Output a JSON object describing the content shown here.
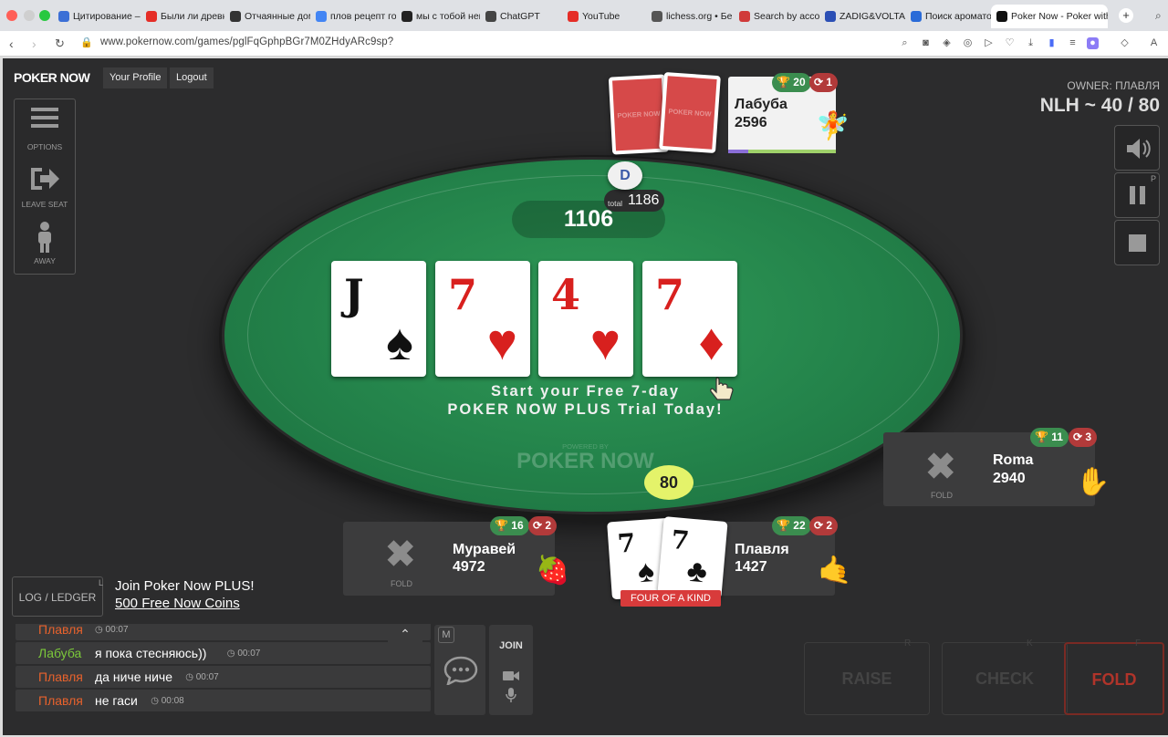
{
  "browser": {
    "tabs": [
      {
        "label": "Цитирование –",
        "icon": "bookmark-icon",
        "color": "#3b6fd6"
      },
      {
        "label": "Были ли древн",
        "icon": "youtube-icon",
        "color": "#e52d27"
      },
      {
        "label": "Отчаянные дом",
        "icon": "sh-icon",
        "color": "#333333"
      },
      {
        "label": "плов рецепт го",
        "icon": "google-icon",
        "color": "#4285f4"
      },
      {
        "label": "мы с тобой нем",
        "icon": "app-icon",
        "color": "#222222"
      },
      {
        "label": "ChatGPT",
        "icon": "chatgpt-icon",
        "color": "#444444"
      },
      {
        "label": "YouTube",
        "icon": "youtube-icon",
        "color": "#e52d27"
      },
      {
        "label": "lichess.org • Бе",
        "icon": "lichess-icon",
        "color": "#555555"
      },
      {
        "label": "Search by acco",
        "icon": "search-site-icon",
        "color": "#d03a3a"
      },
      {
        "label": "ZADIG&VOLTAIR",
        "icon": "zadig-icon",
        "color": "#2b4fb5"
      },
      {
        "label": "Поиск аромато",
        "icon": "f-icon",
        "color": "#2a6bd8"
      },
      {
        "label": "Poker Now - Poker with",
        "icon": "pokernow-icon",
        "color": "#111111"
      }
    ],
    "url": "www.pokernow.com/games/pglFqGphpBGr7M0ZHdyARc9sp?"
  },
  "header": {
    "logo": "POKER NOW",
    "profile": "Your Profile",
    "logout": "Logout",
    "owner": "OWNER: ПЛАВЛЯ",
    "blinds": "NLH ~ 40 / 80"
  },
  "sidebar": {
    "options": "OPTIONS",
    "leave_seat": "LEAVE SEAT",
    "away": "AWAY"
  },
  "table": {
    "dealer": "D",
    "total_label": "total",
    "total": "1186",
    "pot": "1106",
    "promo_line1": "Start your Free 7-day",
    "promo_line2": "POKER NOW PLUS Trial Today!",
    "powered_by": "POWERED BY",
    "watermark": "POKER NOW",
    "board": [
      {
        "rank": "J",
        "suit": "♠",
        "color": "black"
      },
      {
        "rank": "7",
        "suit": "♥",
        "color": "red"
      },
      {
        "rank": "4",
        "suit": "♥",
        "color": "red"
      },
      {
        "rank": "7",
        "suit": "♦",
        "color": "red"
      }
    ],
    "bet": "80"
  },
  "players": {
    "labuba": {
      "name": "Лабуба",
      "stack": "2596",
      "wins": "20",
      "rebuys": "1",
      "emoji": "🧚",
      "card_back_text": "POKER NOW"
    },
    "roma": {
      "name": "Roma",
      "stack": "2940",
      "wins": "11",
      "rebuys": "3",
      "emoji": "✋",
      "fold": "FOLD"
    },
    "muravei": {
      "name": "Муравей",
      "stack": "4972",
      "wins": "16",
      "rebuys": "2",
      "emoji": "🍓",
      "fold": "FOLD"
    },
    "plavlya": {
      "name": "Плавля",
      "stack": "1427",
      "wins": "22",
      "rebuys": "2",
      "emoji": "🤙",
      "hand_name": "FOUR OF A KIND",
      "cards": [
        {
          "rank": "7",
          "suit": "♠"
        },
        {
          "rank": "7",
          "suit": "♣"
        }
      ]
    }
  },
  "bottom": {
    "log_button": "LOG / LEDGER",
    "log_key": "L",
    "join_plus": "Join Poker Now PLUS!",
    "coins": "500 Free Now Coins",
    "chat_key": "M",
    "join": "JOIN",
    "chat": [
      {
        "name": "Плавля",
        "color": "#e8622c",
        "msg": "",
        "time": "00:07"
      },
      {
        "name": "Лабуба",
        "color": "#7bc83b",
        "msg": "я пока стесняюсь))",
        "time": "00:07"
      },
      {
        "name": "Плавля",
        "color": "#e8622c",
        "msg": "да ниче ниче",
        "time": "00:07"
      },
      {
        "name": "Плавля",
        "color": "#e8622c",
        "msg": "не гаси",
        "time": "00:08"
      }
    ],
    "actions": {
      "raise": "RAISE",
      "raise_key": "R",
      "check": "CHECK",
      "check_key": "K",
      "fold": "FOLD",
      "fold_key": "F"
    }
  },
  "controls": {
    "pause_key": "P"
  }
}
